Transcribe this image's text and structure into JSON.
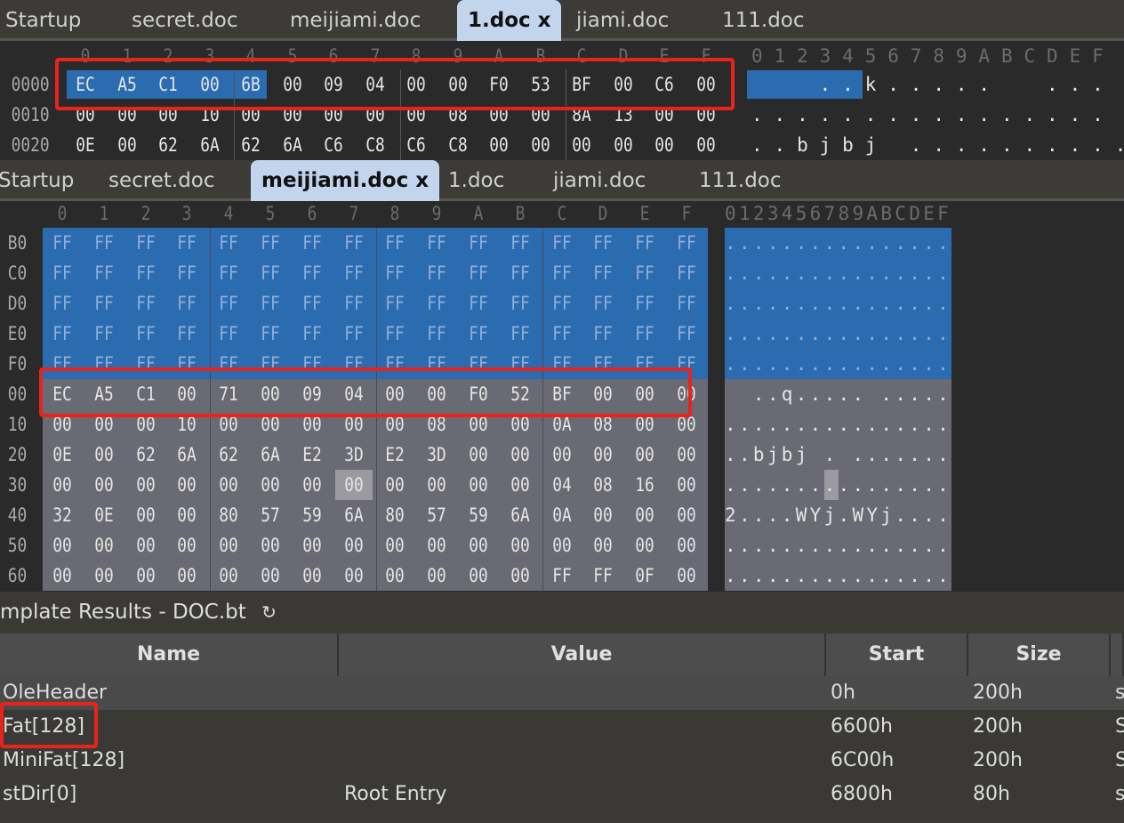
{
  "top_tabs": [
    "Startup",
    "secret.doc",
    "meijiami.doc",
    "1.doc",
    "jiami.doc",
    "111.doc"
  ],
  "top_active_tab": 3,
  "close_glyph": "x",
  "top_pane": {
    "column_headers": [
      "0",
      "1",
      "2",
      "3",
      "4",
      "5",
      "6",
      "7",
      "8",
      "9",
      "A",
      "B",
      "C",
      "D",
      "E",
      "F"
    ],
    "rows": [
      {
        "offset": "0000",
        "bytes": [
          "EC",
          "A5",
          "C1",
          "00",
          "6B",
          "00",
          "09",
          "04",
          "00",
          "00",
          "F0",
          "53",
          "BF",
          "00",
          "C6",
          "00"
        ],
        "ascii": "   ..k.....  ...  .",
        "selected_bytes": 5
      },
      {
        "offset": "0010",
        "bytes": [
          "00",
          "00",
          "00",
          "10",
          "00",
          "00",
          "00",
          "00",
          "00",
          "08",
          "00",
          "00",
          "8A",
          "13",
          "00",
          "00"
        ],
        "ascii": "................"
      },
      {
        "offset": "0020",
        "bytes": [
          "0E",
          "00",
          "62",
          "6A",
          "62",
          "6A",
          "C6",
          "C8",
          "C6",
          "C8",
          "00",
          "00",
          "00",
          "00",
          "00",
          "00"
        ],
        "ascii": "..bjbj .........."
      }
    ]
  },
  "bottom_tabs": [
    "Startup",
    "secret.doc",
    "meijiami.doc",
    "1.doc",
    "jiami.doc",
    "111.doc"
  ],
  "bottom_active_tab": 2,
  "bottom_pane": {
    "column_headers": [
      "0",
      "1",
      "2",
      "3",
      "4",
      "5",
      "6",
      "7",
      "8",
      "9",
      "A",
      "B",
      "C",
      "D",
      "E",
      "F"
    ],
    "ascii_header": "0123456789ABCDEF",
    "rows": [
      {
        "offset": "B0",
        "bytes": [
          "FF",
          "FF",
          "FF",
          "FF",
          "FF",
          "FF",
          "FF",
          "FF",
          "FF",
          "FF",
          "FF",
          "FF",
          "FF",
          "FF",
          "FF",
          "FF"
        ],
        "ascii": "................",
        "selected": true
      },
      {
        "offset": "C0",
        "bytes": [
          "FF",
          "FF",
          "FF",
          "FF",
          "FF",
          "FF",
          "FF",
          "FF",
          "FF",
          "FF",
          "FF",
          "FF",
          "FF",
          "FF",
          "FF",
          "FF"
        ],
        "ascii": "................",
        "selected": true
      },
      {
        "offset": "D0",
        "bytes": [
          "FF",
          "FF",
          "FF",
          "FF",
          "FF",
          "FF",
          "FF",
          "FF",
          "FF",
          "FF",
          "FF",
          "FF",
          "FF",
          "FF",
          "FF",
          "FF"
        ],
        "ascii": "................",
        "selected": true
      },
      {
        "offset": "E0",
        "bytes": [
          "FF",
          "FF",
          "FF",
          "FF",
          "FF",
          "FF",
          "FF",
          "FF",
          "FF",
          "FF",
          "FF",
          "FF",
          "FF",
          "FF",
          "FF",
          "FF"
        ],
        "ascii": "................",
        "selected": true
      },
      {
        "offset": "F0",
        "bytes": [
          "FF",
          "FF",
          "FF",
          "FF",
          "FF",
          "FF",
          "FF",
          "FF",
          "FF",
          "FF",
          "FF",
          "FF",
          "FF",
          "FF",
          "FF",
          "FF"
        ],
        "ascii": "................",
        "selected": true
      },
      {
        "offset": "00",
        "bytes": [
          "EC",
          "A5",
          "C1",
          "00",
          "71",
          "00",
          "09",
          "04",
          "00",
          "00",
          "F0",
          "52",
          "BF",
          "00",
          "00",
          "00"
        ],
        "ascii": "  ..q..... ....."
      },
      {
        "offset": "10",
        "bytes": [
          "00",
          "00",
          "00",
          "10",
          "00",
          "00",
          "00",
          "00",
          "00",
          "08",
          "00",
          "00",
          "0A",
          "08",
          "00",
          "00"
        ],
        "ascii": "................"
      },
      {
        "offset": "20",
        "bytes": [
          "0E",
          "00",
          "62",
          "6A",
          "62",
          "6A",
          "E2",
          "3D",
          "E2",
          "3D",
          "00",
          "00",
          "00",
          "00",
          "00",
          "00"
        ],
        "ascii": "..bjbj . ......."
      },
      {
        "offset": "30",
        "bytes": [
          "00",
          "00",
          "00",
          "00",
          "00",
          "00",
          "00",
          "00",
          "00",
          "00",
          "00",
          "00",
          "04",
          "08",
          "16",
          "00"
        ],
        "ascii": "................",
        "cursor": 7
      },
      {
        "offset": "40",
        "bytes": [
          "32",
          "0E",
          "00",
          "00",
          "80",
          "57",
          "59",
          "6A",
          "80",
          "57",
          "59",
          "6A",
          "0A",
          "00",
          "00",
          "00"
        ],
        "ascii": "2....WYj.WYj...."
      },
      {
        "offset": "50",
        "bytes": [
          "00",
          "00",
          "00",
          "00",
          "00",
          "00",
          "00",
          "00",
          "00",
          "00",
          "00",
          "00",
          "00",
          "00",
          "00",
          "00"
        ],
        "ascii": "................"
      },
      {
        "offset": "60",
        "bytes": [
          "00",
          "00",
          "00",
          "00",
          "00",
          "00",
          "00",
          "00",
          "00",
          "00",
          "00",
          "00",
          "FF",
          "FF",
          "0F",
          "00"
        ],
        "ascii": "................"
      }
    ]
  },
  "template_results": {
    "title": "mplate Results - DOC.bt",
    "refresh_icon": "refresh-icon",
    "columns": [
      "Name",
      "Value",
      "Start",
      "Size"
    ],
    "rows": [
      {
        "name": "OleHeader",
        "value": "",
        "start": "0h",
        "size": "200h",
        "extra": "s"
      },
      {
        "name": "Fat[128]",
        "value": "",
        "start": "6600h",
        "size": "200h",
        "extra": "S"
      },
      {
        "name": "MiniFat[128]",
        "value": "",
        "start": "6C00h",
        "size": "200h",
        "extra": "S"
      },
      {
        "name": "stDir[0]",
        "value": "Root Entry",
        "start": "6800h",
        "size": "80h",
        "extra": "s"
      }
    ]
  },
  "colors": {
    "selection": "#2b6cb0",
    "gray_rows": "#696a73",
    "highlight": "#e8231c",
    "active_tab": "#c3d5ec"
  }
}
